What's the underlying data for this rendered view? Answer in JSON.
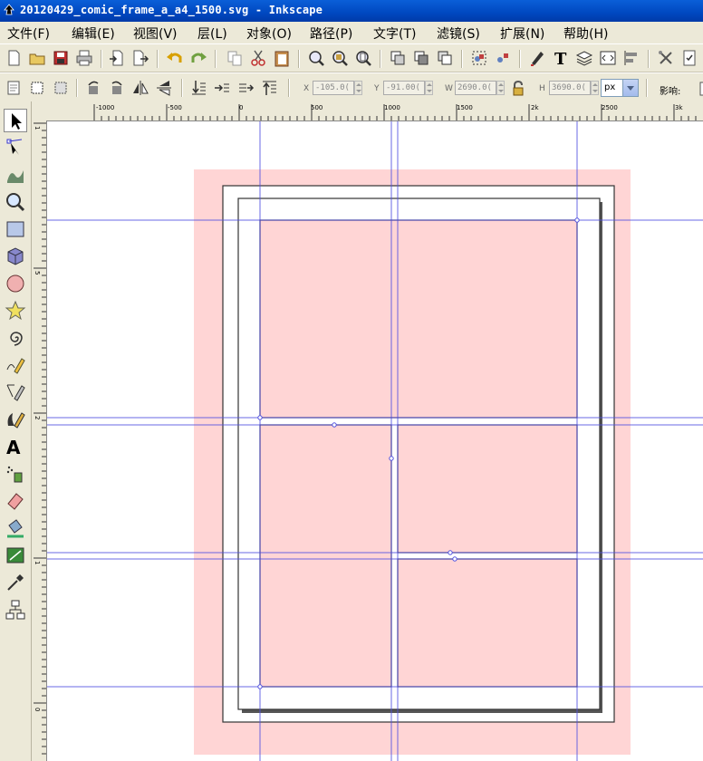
{
  "window": {
    "title": "20120429_comic_frame_a_a4_1500.svg - Inkscape"
  },
  "menu": [
    {
      "label": "文件(F)"
    },
    {
      "label": "编辑(E)"
    },
    {
      "label": "视图(V)"
    },
    {
      "label": "层(L)"
    },
    {
      "label": "对象(O)"
    },
    {
      "label": "路径(P)"
    },
    {
      "label": "文字(T)"
    },
    {
      "label": "滤镜(S)"
    },
    {
      "label": "扩展(N)"
    },
    {
      "label": "帮助(H)"
    }
  ],
  "tool_controls": {
    "x": {
      "label": "X",
      "value": "-105.0("
    },
    "y": {
      "label": "Y",
      "value": "-91.00("
    },
    "w": {
      "label": "W",
      "value": "2690.0("
    },
    "h": {
      "label": "H",
      "value": "3690.0("
    },
    "unit": "px",
    "affect_label": "影响:"
  },
  "rulers": {
    "h_ticks": [
      "-1000",
      "-500",
      "0",
      "500",
      "1000",
      "1500",
      "2k",
      "2500",
      "3k"
    ],
    "v_ticks": [
      "1",
      "5",
      "2",
      "1",
      "0"
    ]
  },
  "colors": {
    "page_shadow_fill": "#ffd5d5",
    "panel_fill": "#ffd5d5",
    "guide": "#5050e0",
    "border": "#333333"
  }
}
